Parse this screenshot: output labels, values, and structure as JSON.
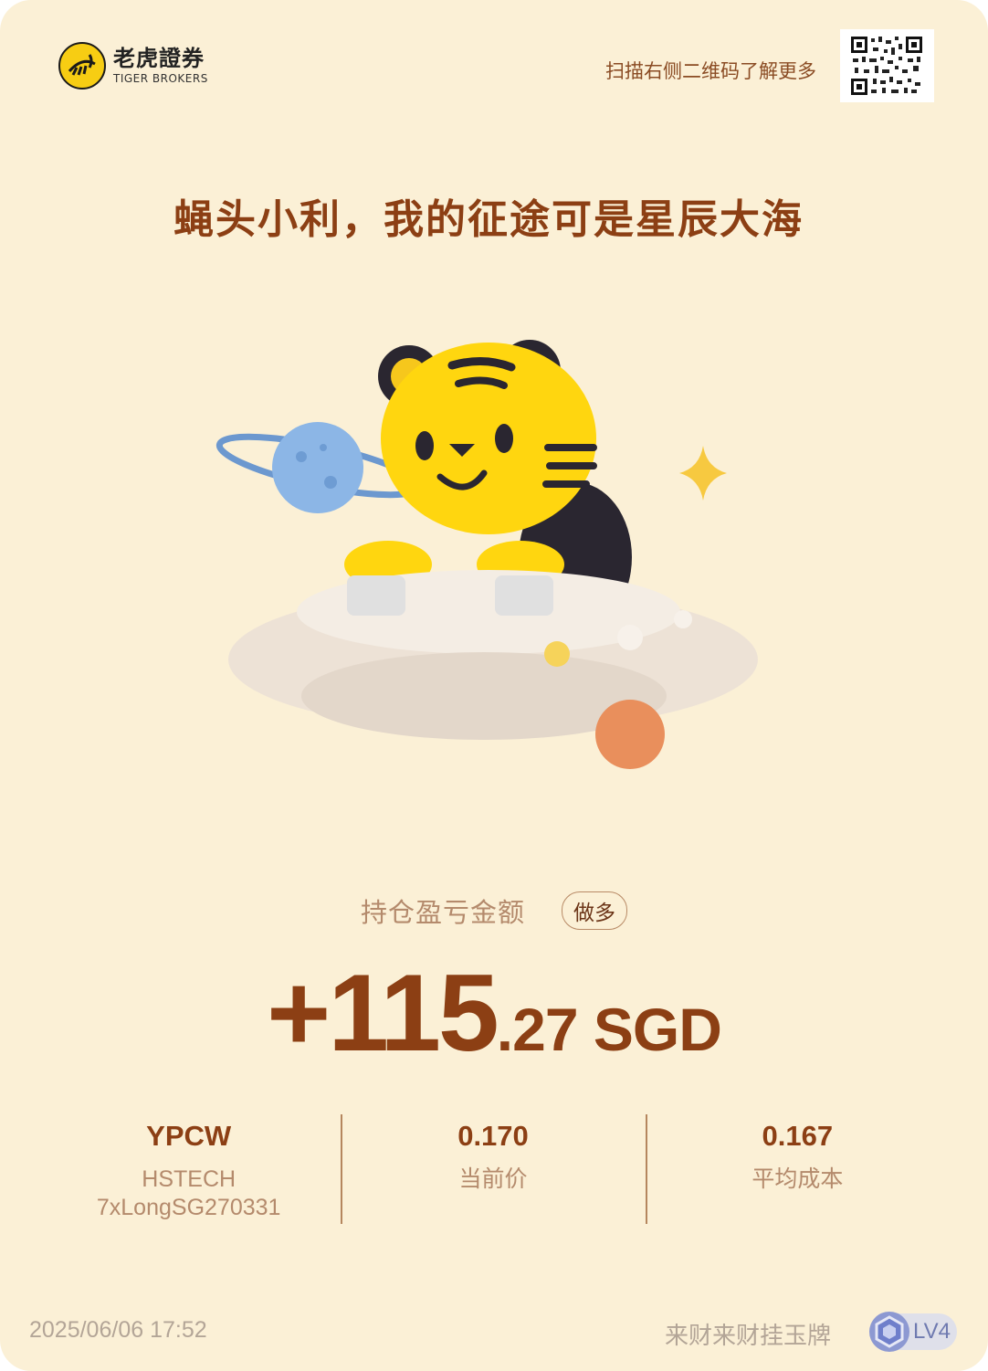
{
  "brand": {
    "name_cn": "老虎證券",
    "name_en": "TIGER BROKERS"
  },
  "header": {
    "scan_hint": "扫描右侧二维码了解更多"
  },
  "slogan": "蝇头小利，我的征途可是星辰大海",
  "position": {
    "pnl_label": "持仓盈亏金额",
    "direction_badge": "做多",
    "amount_int": "+115",
    "amount_dec": ".27 SGD"
  },
  "stats": {
    "symbol": "YPCW",
    "symbol_name_line1": "HSTECH",
    "symbol_name_line2": "7xLongSG270331",
    "current_price": "0.170",
    "current_price_label": "当前价",
    "avg_cost": "0.167",
    "avg_cost_label": "平均成本"
  },
  "footer": {
    "datetime": "2025/06/06 17:52",
    "user_title": "来财来财挂玉牌",
    "level": "LV4"
  },
  "colors": {
    "background": "#fbf0d6",
    "accent_brown": "#8c3f14",
    "muted": "#b48a6c",
    "brand_yellow": "#f7cd13"
  }
}
